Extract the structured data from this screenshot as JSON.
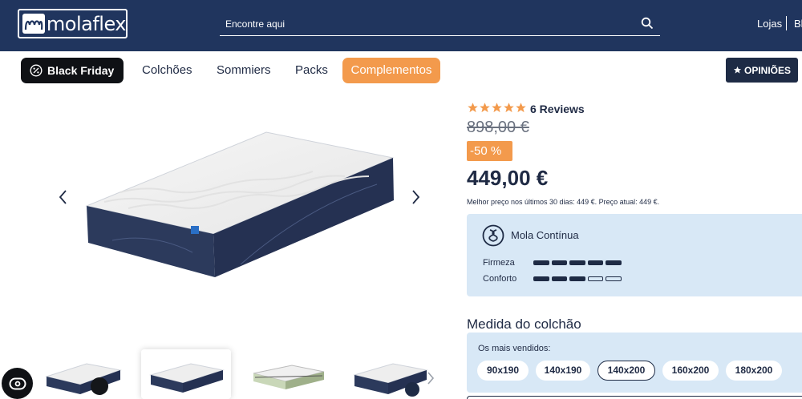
{
  "header": {
    "logo_text": "molaflex",
    "search_placeholder": "Encontre aqui",
    "links": [
      "Lojas",
      "Bl"
    ]
  },
  "nav": {
    "black_friday": "Black Friday",
    "items": [
      "Colchões",
      "Sommiers",
      "Packs"
    ],
    "active": "Complementos",
    "reviews_button": "OPINIÕES"
  },
  "product": {
    "rating": 5,
    "reviews": "6 Reviews",
    "old_price": "898,00 €",
    "discount": "-50 %",
    "price": "449,00 €",
    "price_note": "Melhor preço nos últimos 30 dias: 449 €. Preço atual: 449 €.",
    "spring_type": "Mola Contínua",
    "firmness_label": "Firmeza",
    "firmness_level": 5,
    "comfort_label": "Conforto",
    "comfort_level": 3,
    "scale_max": 5
  },
  "sizes": {
    "title": "Medida do colchão",
    "best_sellers_label": "Os mais vendidos:",
    "options": [
      "90x190",
      "140x190",
      "140x200",
      "160x200",
      "180x200"
    ],
    "selected": "140x200"
  },
  "colors": {
    "header_bg": "#20355e",
    "accent": "#f39a4c",
    "dark": "#1e2b45",
    "panel": "#d8e8f6",
    "star": "#f39a4c"
  }
}
